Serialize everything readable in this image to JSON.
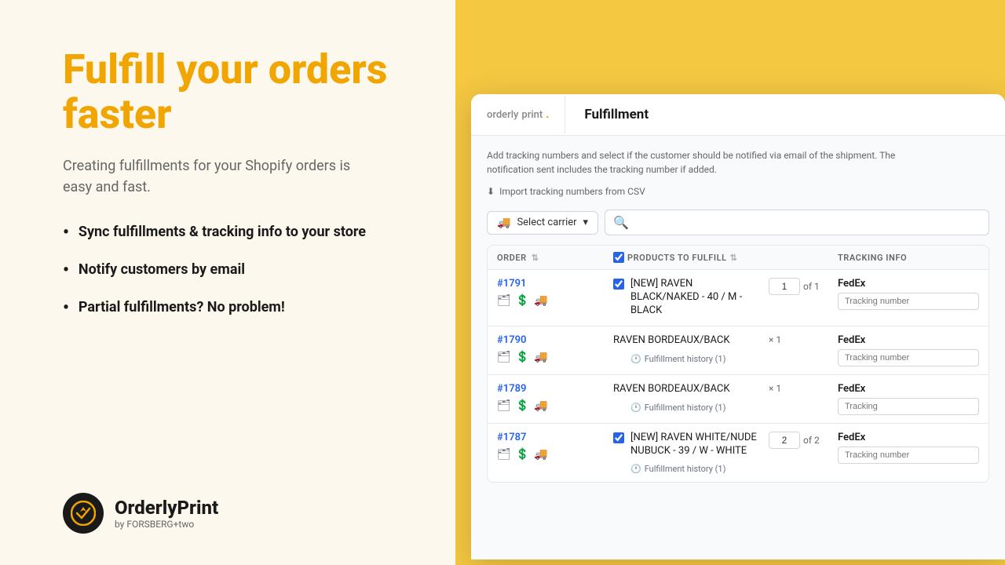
{
  "left": {
    "hero_title": "Fulfill your orders faster",
    "hero_subtitle": "Creating fulfillments for your Shopify orders is easy and fast.",
    "bullets": [
      "Sync fulfillments & tracking info to your store",
      "Notify customers by email",
      "Partial fulfillments? No problem!"
    ],
    "logo_name": "OrderlyPrint",
    "logo_sub": "by FORSBERG+two"
  },
  "app": {
    "brand_orderly": "orderly",
    "brand_print": "print",
    "brand_dot": ".",
    "tab_label": "Fulfillment",
    "info_text": "Add tracking numbers and select if the customer should be notified via email of the shipment. The notification sent includes the tracking number if added.",
    "import_link": "Import tracking numbers from CSV",
    "carrier_select_label": "Select carrier",
    "search_placeholder": "",
    "table": {
      "col_order": "ORDER",
      "col_products": "PRODUCTS TO FULFILL",
      "col_tracking": "TRACKING INFO",
      "rows": [
        {
          "id": "#1791",
          "product": "[NEW] RAVEN BLACK/NAKED - 40 / M - BLACK",
          "qty": "1",
          "qty_total": "1",
          "carrier": "FedEx",
          "tracking_placeholder": "Tracking number",
          "has_checkbox": true,
          "checkbox_checked": true,
          "history": null
        },
        {
          "id": "#1790",
          "product": "RAVEN BORDEAUX/BACK",
          "qty": null,
          "qty_total": null,
          "carrier": "FedEx",
          "tracking_placeholder": "Tracking number",
          "has_checkbox": false,
          "checkbox_checked": false,
          "multiplier": "× 1",
          "history": "Fulfillment history (1)"
        },
        {
          "id": "#1789",
          "product": "RAVEN BORDEAUX/BACK",
          "qty": null,
          "qty_total": null,
          "carrier": "FedEx",
          "tracking_placeholder": "Tracking",
          "has_checkbox": false,
          "checkbox_checked": false,
          "multiplier": "× 1",
          "history": "Fulfillment history (1)"
        },
        {
          "id": "#1787",
          "product": "[NEW] RAVEN WHITE/NUDE NUBUCK - 39 / W - WHITE",
          "qty": "2",
          "qty_total": "2",
          "carrier": "FedEx",
          "tracking_placeholder": "Tracking number",
          "has_checkbox": true,
          "checkbox_checked": true,
          "history": "Fulfillment history (1)"
        }
      ]
    }
  },
  "colors": {
    "accent": "#f0a500",
    "link": "#2563eb",
    "positive": "#16a34a"
  }
}
